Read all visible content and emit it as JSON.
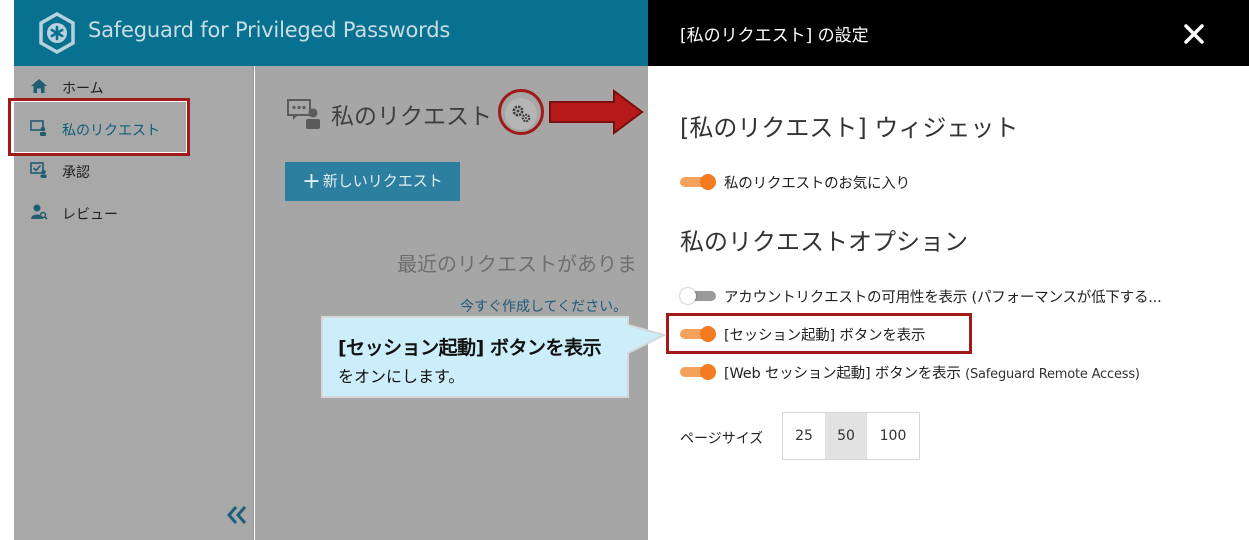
{
  "app": {
    "title": "Safeguard for Privileged Passwords"
  },
  "sidebar": {
    "items": [
      {
        "label": "ホーム",
        "icon": "home-icon"
      },
      {
        "label": "私のリクエスト",
        "icon": "my-requests-icon",
        "active": true
      },
      {
        "label": "承認",
        "icon": "approval-icon"
      },
      {
        "label": "レビュー",
        "icon": "review-icon"
      }
    ]
  },
  "main": {
    "page_title": "私のリクエスト",
    "new_request_label": "新しいリクエスト",
    "empty_message": "最近のリクエストがありま",
    "create_link": "今すぐ作成してください。"
  },
  "panel": {
    "title": "[私のリクエスト] の設定",
    "widget_section": "[私のリクエスト] ウィジェット",
    "favorites_toggle": {
      "label": "私のリクエストのお気に入り",
      "on": true
    },
    "options_section": "私のリクエストオプション",
    "options": [
      {
        "label": "アカウントリクエストの可用性を表示 (パフォーマンスが低下する...",
        "on": false
      },
      {
        "label": "[セッション起動] ボタンを表示",
        "on": true
      },
      {
        "label": "[Web セッション起動] ボタンを表示",
        "sub": "(Safeguard Remote Access)",
        "on": true
      }
    ],
    "page_size_label": "ページサイズ",
    "page_sizes": [
      "25",
      "50",
      "100"
    ],
    "page_size_selected": "50"
  },
  "callout": {
    "title": "[セッション起動] ボタンを表示",
    "body": "をオンにします。"
  },
  "colors": {
    "app_header": "#08718f",
    "panel_header": "#000000",
    "toggle_on": "#f47b20",
    "annotation_red": "#a11a1a",
    "callout_fill": "#cbeefa"
  }
}
